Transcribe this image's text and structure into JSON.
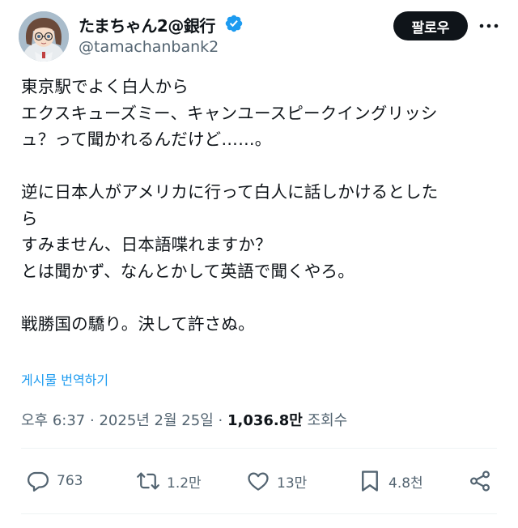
{
  "author": {
    "display_name": "たまちゃん2@銀行",
    "handle": "@tamachanbank2",
    "verified_icon": "verified-badge-icon",
    "colors": {
      "verified": "#1d9bf0"
    }
  },
  "header": {
    "follow_label": "팔로우",
    "more_icon": "more-horizontal-icon"
  },
  "tweet": {
    "lines": [
      "東京駅でよく白人から",
      "エクスキューズミー、キャンユースピークイングリッシ",
      "ュ？って聞かれるんだけど……。",
      "",
      "逆に日本人がアメリカに行って白人に話しかけるとした",
      "ら",
      "すみません、日本語喋れますか？",
      "とは聞かず、なんとかして英語で聞くやろ。",
      "",
      "戦勝国の驕り。決して許さぬ。"
    ],
    "translate_label": "게시물 번역하기"
  },
  "meta": {
    "time": "오후 6:37",
    "separator": "·",
    "date": "2025년 2월 25일",
    "views_count": "1,036.8만",
    "views_label": "조회수"
  },
  "actions": {
    "replies": "763",
    "reposts": "1.2만",
    "likes": "13만",
    "bookmarks": "4.8천"
  },
  "colors": {
    "text": "#0f1419",
    "secondary": "#536471",
    "link": "#1d9bf0",
    "follow_bg": "#0f1419",
    "divider": "#eff3f4"
  }
}
